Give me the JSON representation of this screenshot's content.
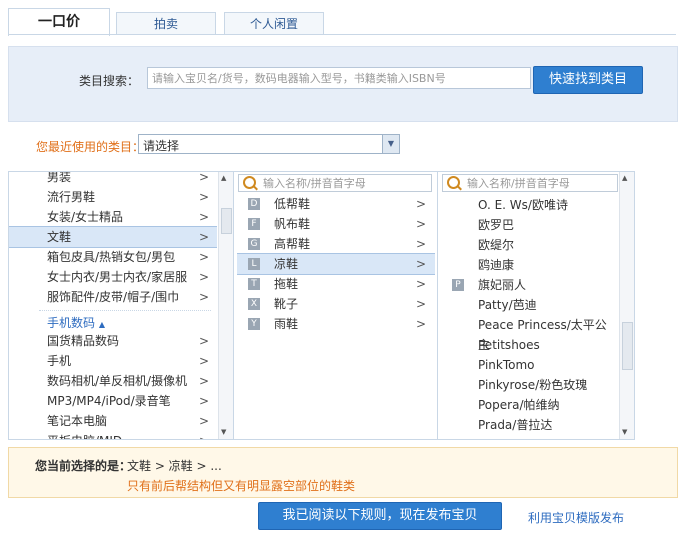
{
  "tabs": [
    {
      "label": "一口价"
    },
    {
      "label": "拍卖"
    },
    {
      "label": "个人闲置"
    }
  ],
  "search": {
    "label": "类目搜索：",
    "placeholder": "请输入宝贝名/货号，数码电器输入型号，书籍类输入ISBN号",
    "button": "快速找到类目"
  },
  "recent": {
    "label": "您最近使用的类目：",
    "value": "请选择"
  },
  "col1": {
    "items": [
      "男装",
      "流行男鞋",
      "女装/女士精品",
      "文鞋",
      "箱包皮具/热销女包/男包",
      "女士内衣/男士内衣/家居服",
      "服饰配件/皮带/帽子/围巾"
    ],
    "selected_index": 3,
    "group_title": "手机数码",
    "group_items": [
      "国货精品数码",
      "手机",
      "数码相机/单反相机/摄像机",
      "MP3/MP4/iPod/录音笔",
      "笔记本电脑",
      "平板电脑/MID"
    ]
  },
  "col2": {
    "filter_placeholder": "输入名称/拼音首字母",
    "items": [
      {
        "letter": "D",
        "label": "低帮鞋"
      },
      {
        "letter": "F",
        "label": "帆布鞋"
      },
      {
        "letter": "G",
        "label": "高帮鞋"
      },
      {
        "letter": "L",
        "label": "凉鞋"
      },
      {
        "letter": "T",
        "label": "拖鞋"
      },
      {
        "letter": "X",
        "label": "靴子"
      },
      {
        "letter": "Y",
        "label": "雨鞋"
      }
    ],
    "selected_index": 3
  },
  "col3": {
    "filter_placeholder": "输入名称/拼音首字母",
    "items": [
      {
        "letter": "",
        "label": "O. E. Ws/欧唯诗"
      },
      {
        "letter": "",
        "label": "欧罗巴"
      },
      {
        "letter": "",
        "label": "欧缇尔"
      },
      {
        "letter": "",
        "label": "鸥迪康"
      },
      {
        "letter": "P",
        "label": "旗妃丽人"
      },
      {
        "letter": "",
        "label": "Patty/芭迪"
      },
      {
        "letter": "",
        "label": "Peace Princess/太平公主"
      },
      {
        "letter": "",
        "label": "Petitshoes"
      },
      {
        "letter": "",
        "label": "PinkTomo"
      },
      {
        "letter": "",
        "label": "Pinkyrose/粉色玫瑰"
      },
      {
        "letter": "",
        "label": "Popera/帕维纳"
      },
      {
        "letter": "",
        "label": "Prada/普拉达"
      }
    ]
  },
  "path": {
    "label": "您当前选择的是：",
    "value": "文鞋 > 凉鞋 > ...",
    "note": "只有前后帮结构但又有明显露空部位的鞋类"
  },
  "actions": {
    "publish": "我已阅读以下规则，现在发布宝贝",
    "template_link": "利用宝贝模版发布"
  }
}
